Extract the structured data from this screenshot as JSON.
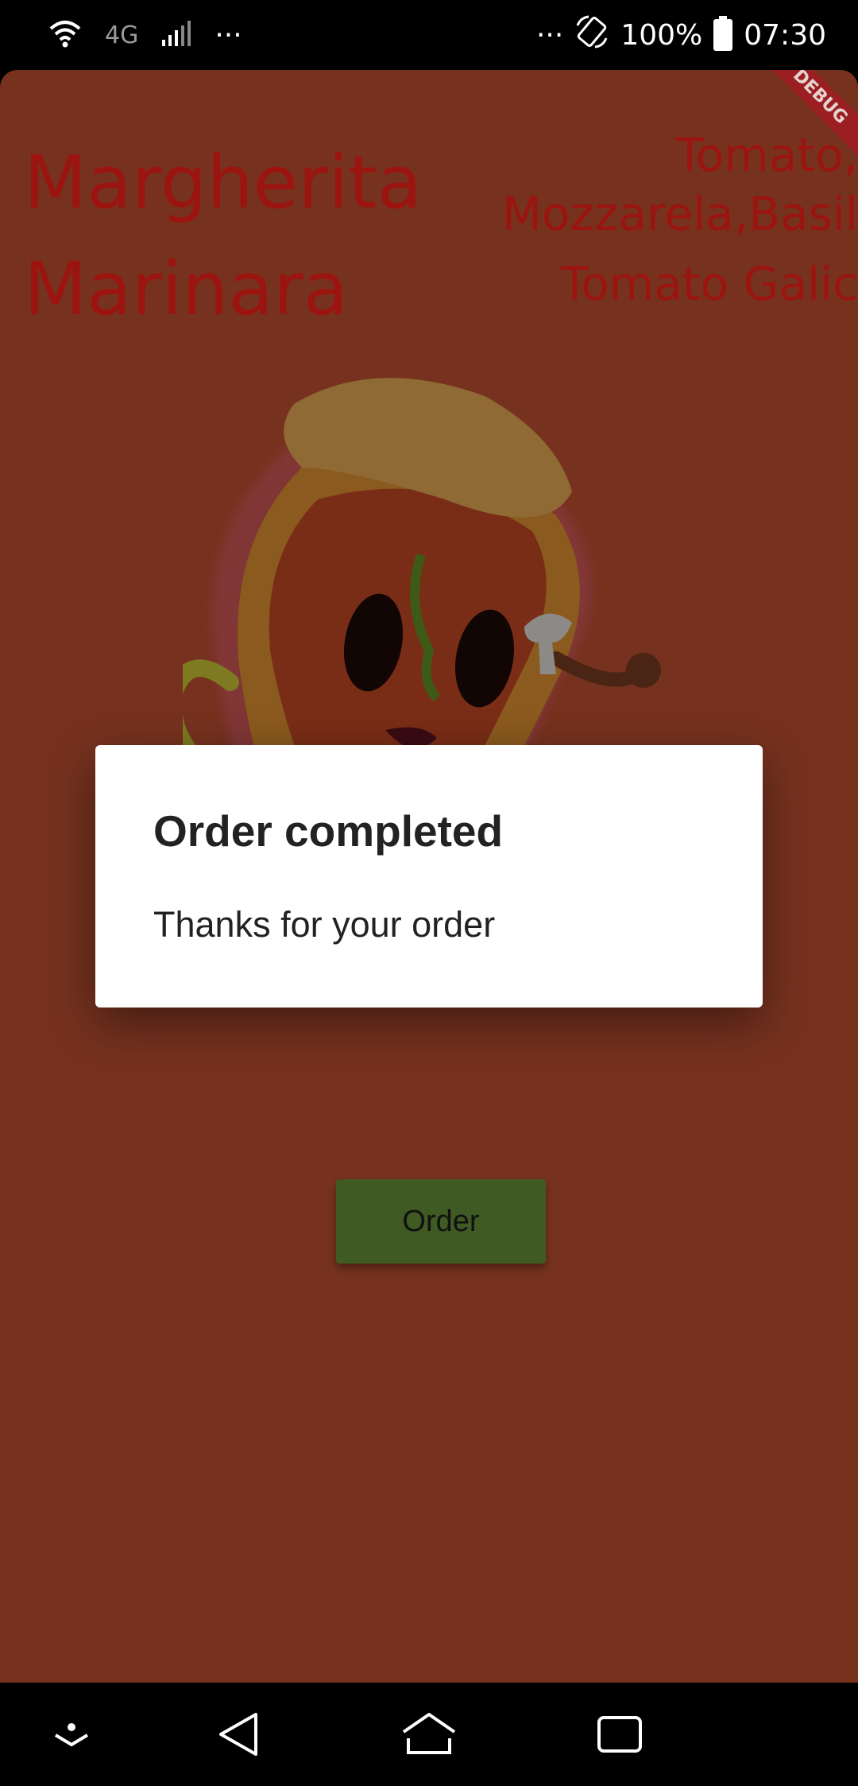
{
  "status_bar": {
    "network_label": "4G",
    "left_more": "···",
    "right_more": "···",
    "battery_percent": "100%",
    "time": "07:30",
    "icons": [
      "wifi-icon",
      "signal-icon",
      "rotate-icon",
      "battery-icon"
    ]
  },
  "app": {
    "debug_banner": "DEBUG",
    "background_color": "#77321f",
    "text_color": "#9b1410",
    "pizzas": [
      {
        "name": "Margherita",
        "ingredients_line1": "Tomato,",
        "ingredients_line2": "Mozzarela,Basil"
      },
      {
        "name": "Marinara",
        "ingredients": "Tomato Galic"
      }
    ],
    "order_button_label": "Order",
    "order_button_color": "#3f5a23"
  },
  "dialog": {
    "title": "Order completed",
    "body": "Thanks for your order"
  },
  "nav_bar": {
    "icons": [
      "dismiss-arrow-icon",
      "back-icon",
      "home-icon",
      "recents-icon"
    ]
  }
}
